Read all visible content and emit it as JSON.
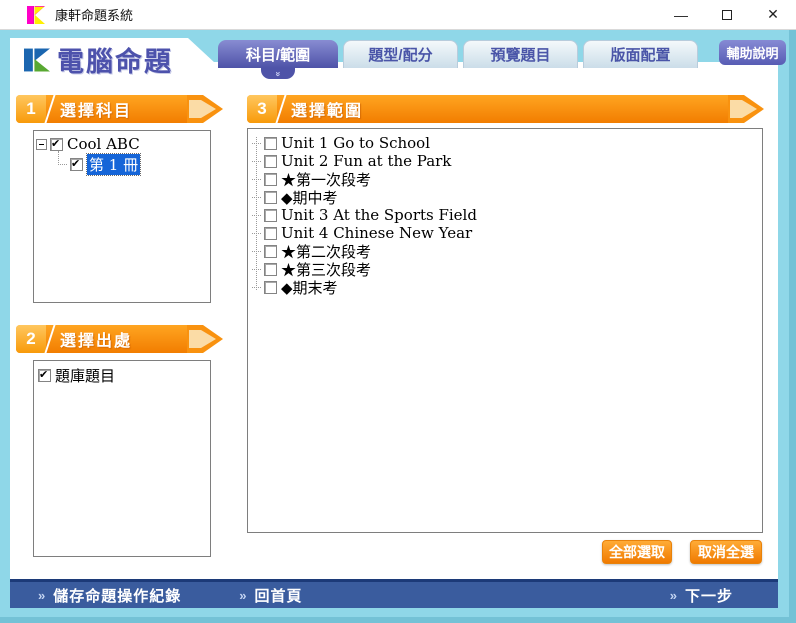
{
  "window": {
    "title": "康軒命題系統",
    "controls": {
      "minimize": "—",
      "close": "✕"
    }
  },
  "header": {
    "logo_text": "電腦命題",
    "help_button": "輔助說明",
    "tabs": [
      {
        "label": "科目/範圍",
        "active": true
      },
      {
        "label": "題型/配分",
        "active": false
      },
      {
        "label": "預覽題目",
        "active": false
      },
      {
        "label": "版面配置",
        "active": false
      }
    ],
    "active_tab_chevron": "»"
  },
  "sections": {
    "subject": {
      "number": "1",
      "title": "選擇科目",
      "tree": {
        "root": {
          "label": "Cool ABC",
          "checked": true,
          "expanded": true
        },
        "child": {
          "label": "第 1 冊",
          "checked": true,
          "selected": true
        }
      }
    },
    "source": {
      "number": "2",
      "title": "選擇出處",
      "items": [
        {
          "label": "題庫題目",
          "checked": true
        }
      ]
    },
    "range": {
      "number": "3",
      "title": "選擇範圍",
      "items": [
        {
          "label": "Unit 1 Go to School",
          "checked": false
        },
        {
          "label": "Unit 2 Fun at the Park",
          "checked": false
        },
        {
          "label": "★第一次段考",
          "checked": false
        },
        {
          "label": "◆期中考",
          "checked": false
        },
        {
          "label": "Unit 3 At the Sports Field",
          "checked": false
        },
        {
          "label": "Unit 4 Chinese New Year",
          "checked": false
        },
        {
          "label": "★第二次段考",
          "checked": false
        },
        {
          "label": "★第三次段考",
          "checked": false
        },
        {
          "label": "◆期末考",
          "checked": false
        }
      ],
      "buttons": {
        "select_all": "全部選取",
        "deselect_all": "取消全選"
      }
    }
  },
  "footer": {
    "chevron": "»",
    "save_log": "儲存命題操作紀錄",
    "home": "回首頁",
    "next": "下一步"
  },
  "colors": {
    "frame_blue": "#8FD7E8",
    "banner_orange": "#F88E0B",
    "active_tab_purple": "#4E53A8",
    "footer_blue": "#3A5C9E",
    "selection_blue": "#1565D8",
    "button_orange": "#F07A00"
  }
}
